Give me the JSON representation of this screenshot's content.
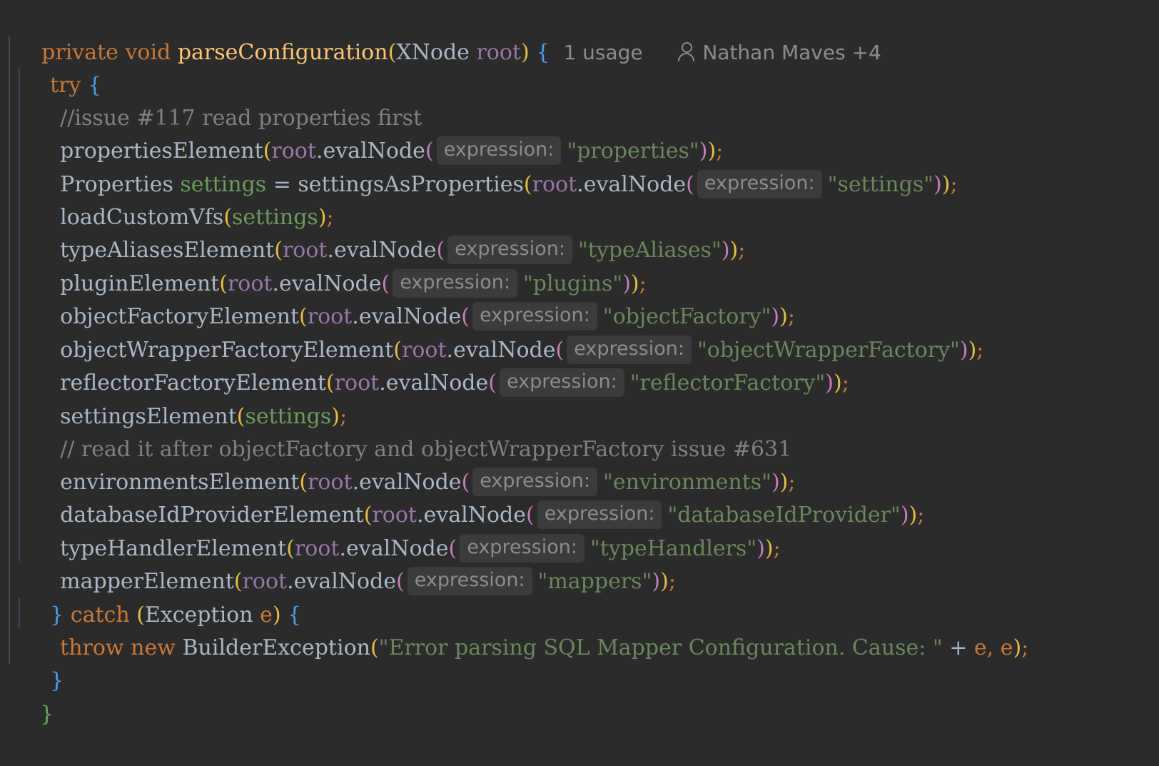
{
  "signature": {
    "modifiers": "private void",
    "method_name": "parseConfiguration",
    "param_type": "XNode",
    "param_name": "root",
    "usage_hint": "1 usage",
    "author_hint": "Nathan Maves +4"
  },
  "keywords": {
    "try": "try",
    "catch": "catch",
    "throw": "throw",
    "new": "new"
  },
  "hint_label": "expression:",
  "comments": {
    "c1": "//issue #117 read properties first",
    "c2": "// read it after objectFactory and objectWrapperFactory issue #631"
  },
  "receiver": "root",
  "eval_method": "evalNode",
  "settings_var": "settings",
  "properties_type": "Properties",
  "settings_func": "settingsAsProperties",
  "calls": {
    "properties": {
      "func": "propertiesElement",
      "arg": "\"properties\""
    },
    "settings": {
      "arg": "\"settings\""
    },
    "loadCustomVfs": {
      "func": "loadCustomVfs"
    },
    "typeAliases": {
      "func": "typeAliasesElement",
      "arg": "\"typeAliases\""
    },
    "plugins": {
      "func": "pluginElement",
      "arg": "\"plugins\""
    },
    "objectFactory": {
      "func": "objectFactoryElement",
      "arg": "\"objectFactory\""
    },
    "objectWrapperFactory": {
      "func": "objectWrapperFactoryElement",
      "arg": "\"objectWrapperFactory\""
    },
    "reflectorFactory": {
      "func": "reflectorFactoryElement",
      "arg": "\"reflectorFactory\""
    },
    "settingsElement": {
      "func": "settingsElement"
    },
    "environments": {
      "func": "environmentsElement",
      "arg": "\"environments\""
    },
    "databaseIdProvider": {
      "func": "databaseIdProviderElement",
      "arg": "\"databaseIdProvider\""
    },
    "typeHandlers": {
      "func": "typeHandlerElement",
      "arg": "\"typeHandlers\""
    },
    "mappers": {
      "func": "mapperElement",
      "arg": "\"mappers\""
    }
  },
  "catch_clause": {
    "exception_type": "Exception",
    "exception_var": "e",
    "builder_exception": "BuilderException",
    "message": "\"Error parsing SQL Mapper Configuration. Cause: \""
  },
  "colors": {
    "background": "#2b2b2b",
    "keyword": "#cc7832",
    "method": "#ffc66d",
    "string": "#6a8759",
    "comment": "#808080",
    "parameter": "#9876aa"
  }
}
